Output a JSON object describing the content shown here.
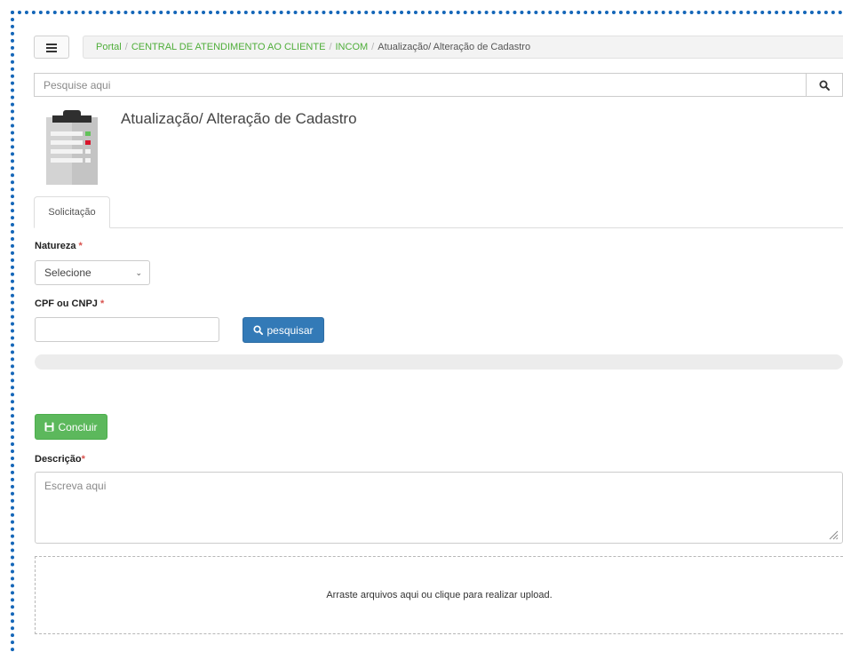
{
  "breadcrumb": {
    "items": [
      "Portal",
      "CENTRAL DE ATENDIMENTO AO CLIENTE",
      "INCOM"
    ],
    "separator": "/",
    "current": "Atualização/ Alteração de Cadastro"
  },
  "search": {
    "placeholder": "Pesquise aqui"
  },
  "page": {
    "title": "Atualização/ Alteração de Cadastro"
  },
  "tabs": [
    {
      "label": "Solicitação",
      "active": true
    }
  ],
  "form": {
    "natureza_label": "Natureza",
    "natureza_value": "Selecione",
    "cpf_label": "CPF ou CNPJ",
    "required_mark": "*",
    "search_button": "pesquisar",
    "concluir_button": "Concluir",
    "descricao_label": "Descrição",
    "descricao_placeholder": "Escreva aqui",
    "upload_text": "Arraste arquivos aqui ou clique para realizar upload."
  },
  "colors": {
    "frame": "#1466b8",
    "link": "#4fae3a",
    "primary": "#337ab7",
    "success": "#5cb85c",
    "required": "#d9534f"
  }
}
